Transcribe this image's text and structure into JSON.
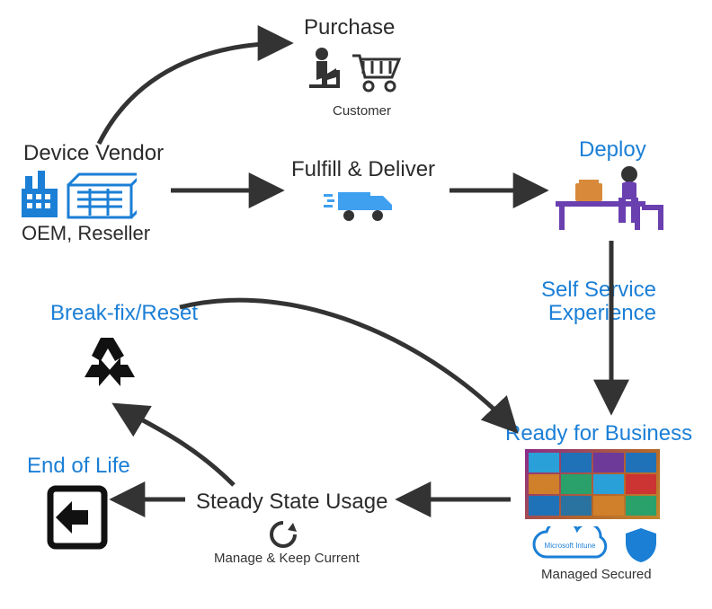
{
  "nodes": {
    "purchase": {
      "title": "Purchase",
      "sub": "Customer"
    },
    "vendor": {
      "title": "Device Vendor",
      "sub": "OEM, Reseller"
    },
    "fulfill": {
      "title": "Fulfill & Deliver"
    },
    "deploy": {
      "title": "Deploy"
    },
    "selfservice": {
      "line1": "Self Service",
      "line2": "Experience"
    },
    "ready": {
      "title": "Ready for Business",
      "sub": "Managed Secured",
      "cloud": "Microsoft Intune"
    },
    "steady": {
      "title": "Steady State Usage",
      "sub": "Manage & Keep Current"
    },
    "breakfix": {
      "title": "Break-fix/Reset"
    },
    "eol": {
      "title": "End of Life"
    }
  }
}
